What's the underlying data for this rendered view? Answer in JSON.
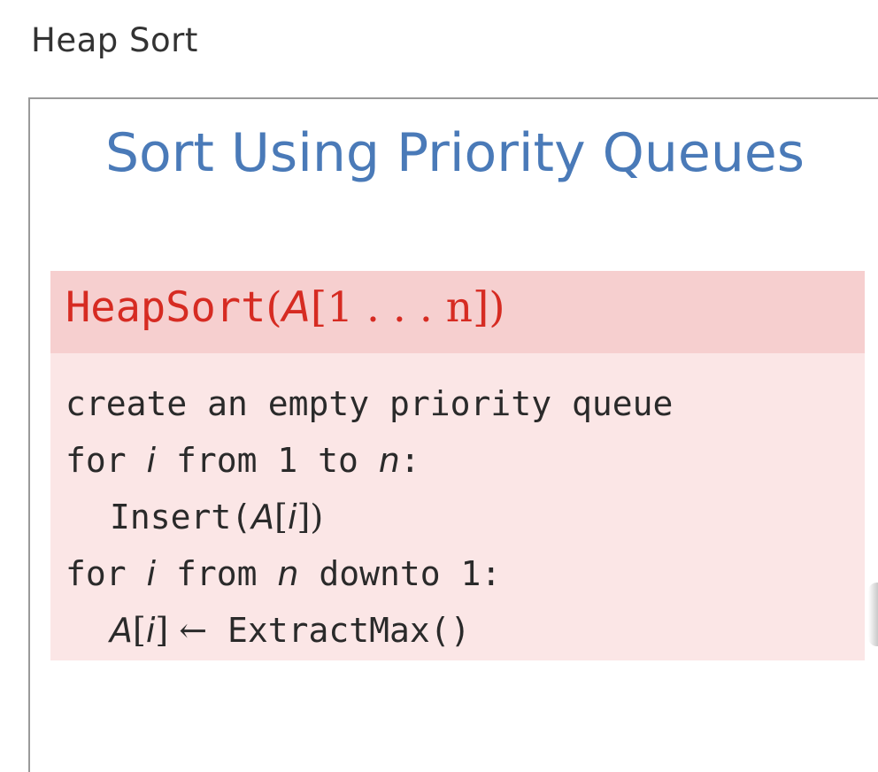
{
  "page": {
    "title": "Heap Sort"
  },
  "slide": {
    "title": "Sort Using Priority Queues",
    "algorithm": {
      "name": "HeapSort",
      "param_array": "A",
      "param_range": "[1 . . . n])",
      "lines": [
        {
          "text": "create an empty priority queue"
        },
        {
          "kw": "for ",
          "var": "i",
          "mid": " from 1 to ",
          "var2": "n",
          "end": ":"
        },
        {
          "call": "Insert(",
          "arr": "A",
          "idx": "[",
          "i": "i",
          "close": "])"
        },
        {
          "kw": "for ",
          "var": "i",
          "mid": " from ",
          "var2": "n",
          "end": " downto 1:"
        },
        {
          "arr": "A",
          "idx_open": "[",
          "i": "i",
          "idx_close": "] ",
          "arrow": "←",
          "call": " ExtractMax()"
        }
      ]
    }
  }
}
